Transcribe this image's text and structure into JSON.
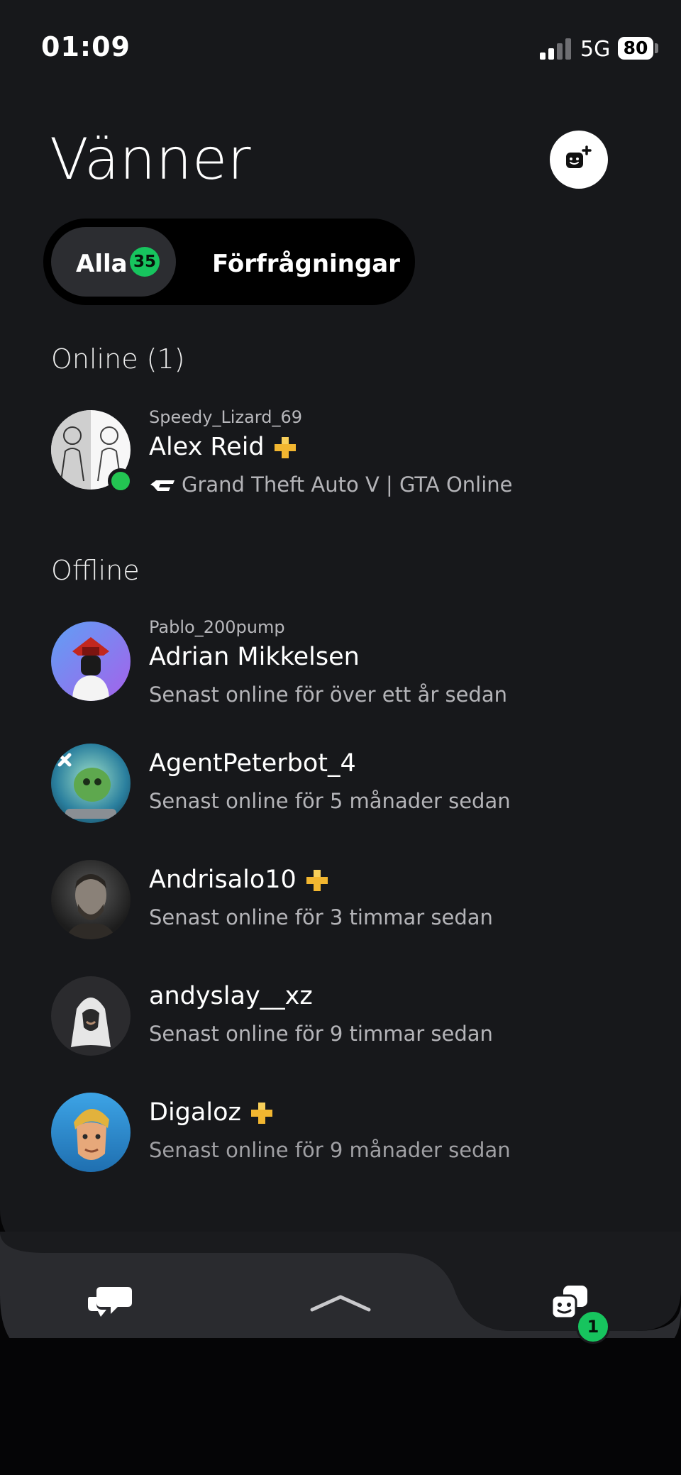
{
  "status_bar": {
    "time": "01:09",
    "network": "5G",
    "battery": "80"
  },
  "header": {
    "title": "Vänner",
    "add_friend_icon": "add-friend-icon"
  },
  "segments": {
    "all_label": "Alla",
    "all_count": "35",
    "requests_label": "Förfrågningar"
  },
  "sections": {
    "online": "Online (1)",
    "offline": "Offline"
  },
  "online_friends": [
    {
      "online_id": "Speedy_Lizard_69",
      "name": "Alex Reid",
      "ps_plus": true,
      "activity": "Grand Theft Auto V | GTA Online"
    }
  ],
  "offline_friends": [
    {
      "online_id": "Pablo_200pump",
      "name": "Adrian Mikkelsen",
      "ps_plus": false,
      "last_seen": "Senast online för över ett år sedan"
    },
    {
      "online_id": "",
      "name": "AgentPeterbot_4",
      "ps_plus": false,
      "last_seen": "Senast online för 5 månader sedan"
    },
    {
      "online_id": "",
      "name": "Andrisalo10",
      "ps_plus": true,
      "last_seen": "Senast online för 3 timmar sedan"
    },
    {
      "online_id": "",
      "name": "andyslay__xz",
      "ps_plus": false,
      "last_seen": "Senast online för 9 timmar sedan"
    },
    {
      "online_id": "",
      "name": "Digaloz",
      "ps_plus": true,
      "last_seen": "Senast online för 9 månader sedan"
    }
  ],
  "bottom_nav": {
    "chat_icon": "chat-bubbles-icon",
    "expand_icon": "chevron-up-icon",
    "friends_icon": "friends-icon",
    "friends_badge": "1"
  },
  "colors": {
    "accent_green": "#17c45e",
    "ps_plus_gold": "#f2b630",
    "panel": "#17181b"
  }
}
